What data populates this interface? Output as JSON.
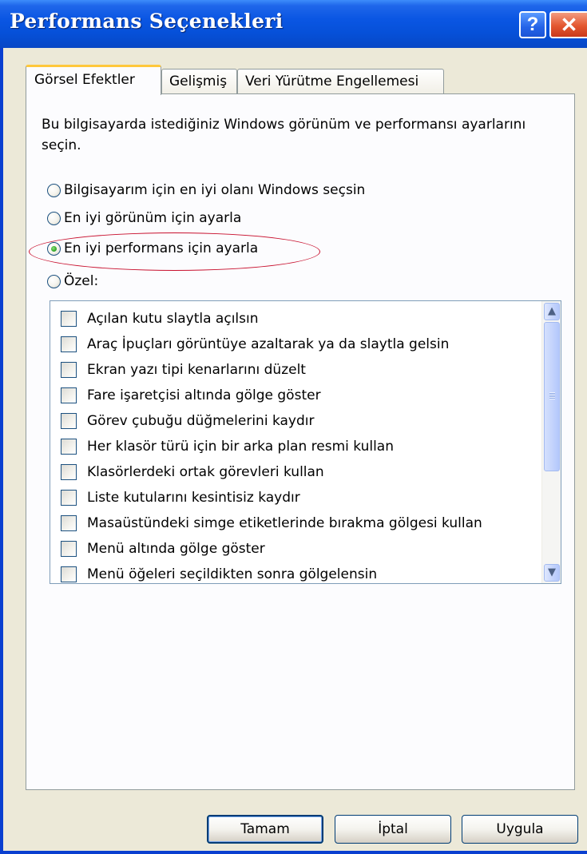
{
  "window": {
    "title": "Performans Seçenekleri",
    "help_glyph": "?",
    "close_glyph": "✕"
  },
  "tabs": [
    {
      "label": "Görsel Efektler",
      "active": true
    },
    {
      "label": "Gelişmiş",
      "active": false
    },
    {
      "label": "Veri Yürütme Engellemesi",
      "active": false
    }
  ],
  "visual_effects": {
    "description": "Bu bilgisayarda istediğiniz Windows görünüm ve performansı ayarlarını seçin.",
    "options": [
      {
        "label": "Bilgisayarım için en iyi olanı Windows seçsin",
        "selected": false
      },
      {
        "label": "En iyi görünüm için ayarla",
        "selected": false
      },
      {
        "label": "En iyi performans için ayarla",
        "selected": true
      },
      {
        "label": "Özel:",
        "selected": false
      }
    ],
    "effects_list": [
      {
        "label": "Açılan kutu slaytla açılsın",
        "checked": false
      },
      {
        "label": "Araç İpuçları görüntüye azaltarak ya da slaytla gelsin",
        "checked": false
      },
      {
        "label": "Ekran yazı tipi kenarlarını düzelt",
        "checked": false
      },
      {
        "label": "Fare işaretçisi altında gölge göster",
        "checked": false
      },
      {
        "label": "Görev çubuğu düğmelerini kaydır",
        "checked": false
      },
      {
        "label": "Her klasör türü için bir arka plan resmi kullan",
        "checked": false
      },
      {
        "label": "Klasörlerdeki ortak görevleri kullan",
        "checked": false
      },
      {
        "label": "Liste kutularını kesintisiz kaydır",
        "checked": false
      },
      {
        "label": "Masaüstündeki simge etiketlerinde bırakma gölgesi kullan",
        "checked": false
      },
      {
        "label": "Menü altında gölge göster",
        "checked": false
      },
      {
        "label": "Menü öğeleri seçildikten sonra gölgelensin",
        "checked": false
      }
    ]
  },
  "buttons": {
    "ok": "Tamam",
    "cancel": "İptal",
    "apply": "Uygula"
  },
  "colors": {
    "titlebar": "#0a56e3",
    "close_button": "#e3572f",
    "active_tab_accent": "#ffc83c",
    "annotation_ellipse": "#c8102e",
    "selected_radio": "#34a82a"
  }
}
